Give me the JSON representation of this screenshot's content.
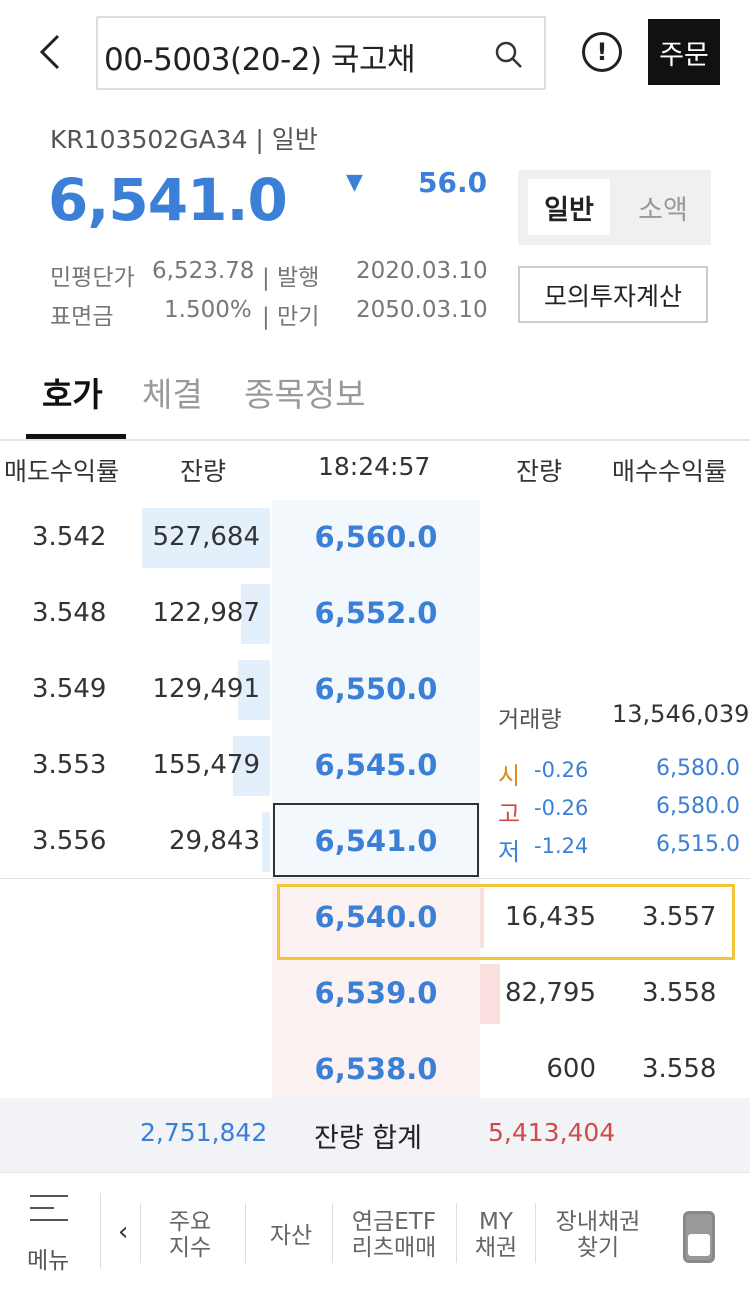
{
  "header": {
    "search_text": "00-5003(20-2)   국고채",
    "order_label": "주문"
  },
  "summary": {
    "code_line": "KR103502GA34 | 일반",
    "price": "6,541.0",
    "direction_symbol": "▼",
    "change": "56.0",
    "eval_label": "민평단가",
    "eval_value": "6,523.78",
    "issue_label": "| 발행",
    "issue_date": "2020.03.10",
    "coupon_label": "표면금",
    "coupon_value": "1.500%",
    "maturity_label": "| 만기",
    "maturity_date": "2050.03.10",
    "toggle_on": "일반",
    "toggle_off": "소액",
    "calc_button": "모의투자계산"
  },
  "tabs": [
    "호가",
    "체결",
    "종목정보"
  ],
  "orderbook": {
    "headers": {
      "ask_yield": "매도수익률",
      "ask_qty": "잔량",
      "time": "18:24:57",
      "bid_qty": "잔량",
      "bid_yield": "매수수익률"
    },
    "asks": [
      {
        "yield": "3.542",
        "qty": "527,684",
        "price": "6,560.0",
        "bar": 1.0
      },
      {
        "yield": "3.548",
        "qty": "122,987",
        "price": "6,552.0",
        "bar": 0.23
      },
      {
        "yield": "3.549",
        "qty": "129,491",
        "price": "6,550.0",
        "bar": 0.25
      },
      {
        "yield": "3.553",
        "qty": "155,479",
        "price": "6,545.0",
        "bar": 0.29
      },
      {
        "yield": "3.556",
        "qty": "29,843",
        "price": "6,541.0",
        "bar": 0.06
      }
    ],
    "bids": [
      {
        "price": "6,540.0",
        "qty": "16,435",
        "yield": "3.557",
        "bar": 0.2
      },
      {
        "price": "6,539.0",
        "qty": "82,795",
        "yield": "3.558",
        "bar": 1.0
      },
      {
        "price": "6,538.0",
        "qty": "600",
        "yield": "3.558",
        "bar": 0.0
      }
    ],
    "stats": {
      "volume_label": "거래량",
      "volume": "13,546,039",
      "open_label": "시",
      "open_change": "-0.26",
      "open_price": "6,580.0",
      "high_label": "고",
      "high_change": "-0.26",
      "high_price": "6,580.0",
      "low_label": "저",
      "low_change": "-1.24",
      "low_price": "6,515.0"
    },
    "totals": {
      "ask_total": "2,751,842",
      "label": "잔량 합계",
      "bid_total": "5,413,404"
    }
  },
  "bottom_nav": {
    "menu": "메뉴",
    "items": [
      {
        "line1": "주요",
        "line2": "지수"
      },
      {
        "line1": "자산",
        "line2": ""
      },
      {
        "line1": "연금ETF",
        "line2": "리츠매매"
      },
      {
        "line1": "MY",
        "line2": "채권"
      },
      {
        "line1": "장내채권",
        "line2": "찾기"
      }
    ]
  },
  "colors": {
    "blue": "#3b7fd6",
    "red": "#d24a4a",
    "highlight": "#f2c637"
  }
}
